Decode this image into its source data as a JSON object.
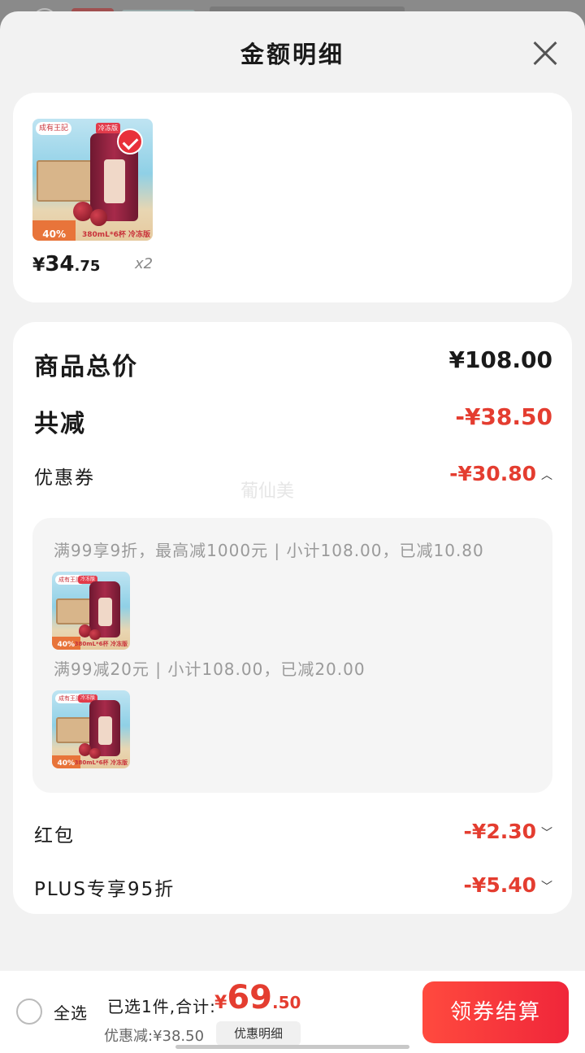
{
  "sheet": {
    "title": "金额明细"
  },
  "product": {
    "brand": "成有王記",
    "tag": "冷冻版",
    "percent": "40%",
    "spec": "380mL*6杯 冷冻版",
    "price_symbol": "¥",
    "price_int": "34",
    "price_dec": ".75",
    "quantity": "x2"
  },
  "details": {
    "total_label": "商品总价",
    "total_value": "¥108.00",
    "reduce_label": "共减",
    "reduce_value": "-¥38.50",
    "coupon_label": "优惠券",
    "coupon_value": "-¥30.80",
    "coupon_lines": [
      "满99享9折，最高减1000元 | 小计108.00，已减10.80",
      "满99减20元 | 小计108.00，已减20.00"
    ],
    "redpacket_label": "红包",
    "redpacket_value": "-¥2.30",
    "plus_label": "PLUS专享95折",
    "plus_value": "-¥5.40"
  },
  "watermark": "葡仙美",
  "bottom": {
    "select_all": "全选",
    "summary": "已选1件,合计:",
    "total_symbol": "¥",
    "total_int": "69",
    "total_dec": ".50",
    "discount": "优惠减:¥38.50",
    "detail_button": "优惠明细",
    "checkout_button": "领券结算"
  },
  "colors": {
    "accent_red": "#e43d30",
    "checkout_gradient": [
      "#ff4a3e",
      "#f0263a"
    ]
  },
  "icons": {
    "close": "close-icon",
    "check": "check-icon",
    "chevron_up": "chevron-up-icon",
    "chevron_down": "chevron-down-icon"
  }
}
